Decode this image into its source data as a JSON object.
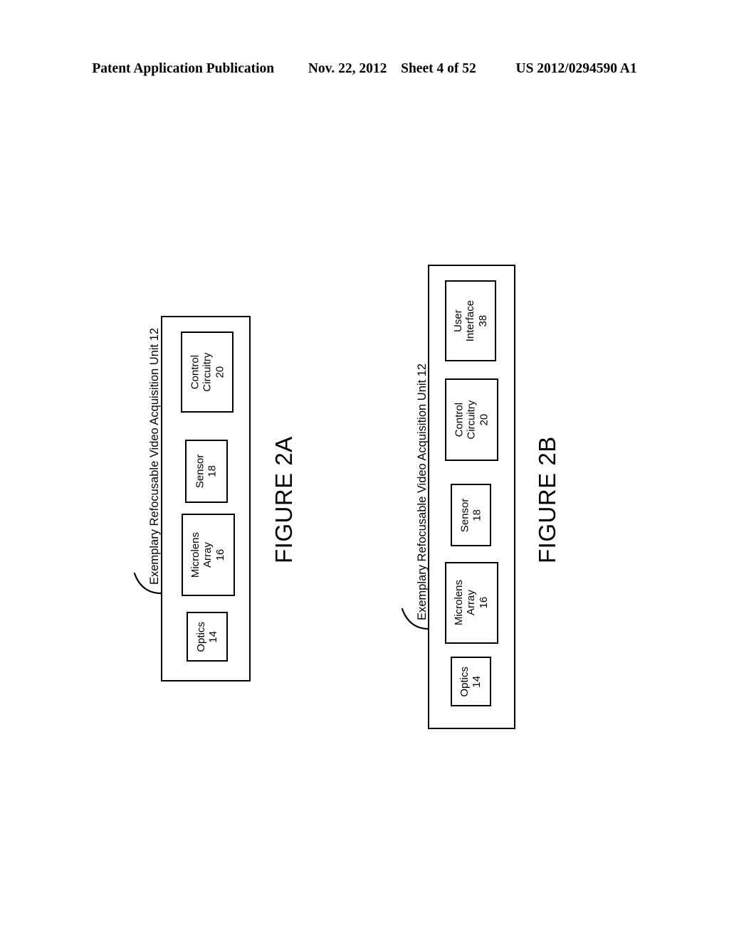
{
  "header": {
    "publication": "Patent Application Publication",
    "date": "Nov. 22, 2012",
    "sheet": "Sheet 4 of 52",
    "pub_number": "US 2012/0294590 A1"
  },
  "figures": [
    {
      "id": "figure-2a",
      "title": "FIGURE 2A",
      "unit_label": "Exemplary Refocusable Video Acquisition Unit 12",
      "components": [
        {
          "name": "control-circuitry",
          "lines": [
            "Control",
            "Circuitry",
            "20"
          ]
        },
        {
          "name": "sensor",
          "lines": [
            "Sensor",
            "18"
          ]
        },
        {
          "name": "microlens-array",
          "lines": [
            "Microlens",
            "Array",
            "16"
          ]
        },
        {
          "name": "optics",
          "lines": [
            "Optics",
            "14"
          ]
        }
      ]
    },
    {
      "id": "figure-2b",
      "title": "FIGURE 2B",
      "unit_label": "Exemplary Refocusable Video Acquisition Unit 12",
      "components": [
        {
          "name": "user-interface",
          "lines": [
            "User",
            "Interface",
            "38"
          ]
        },
        {
          "name": "control-circuitry",
          "lines": [
            "Control",
            "Circuitry",
            "20"
          ]
        },
        {
          "name": "sensor",
          "lines": [
            "Sensor",
            "18"
          ]
        },
        {
          "name": "microlens-array",
          "lines": [
            "Microlens",
            "Array",
            "16"
          ]
        },
        {
          "name": "optics",
          "lines": [
            "Optics",
            "14"
          ]
        }
      ]
    }
  ],
  "colors": {
    "ink": "#000000",
    "paper": "#ffffff"
  }
}
